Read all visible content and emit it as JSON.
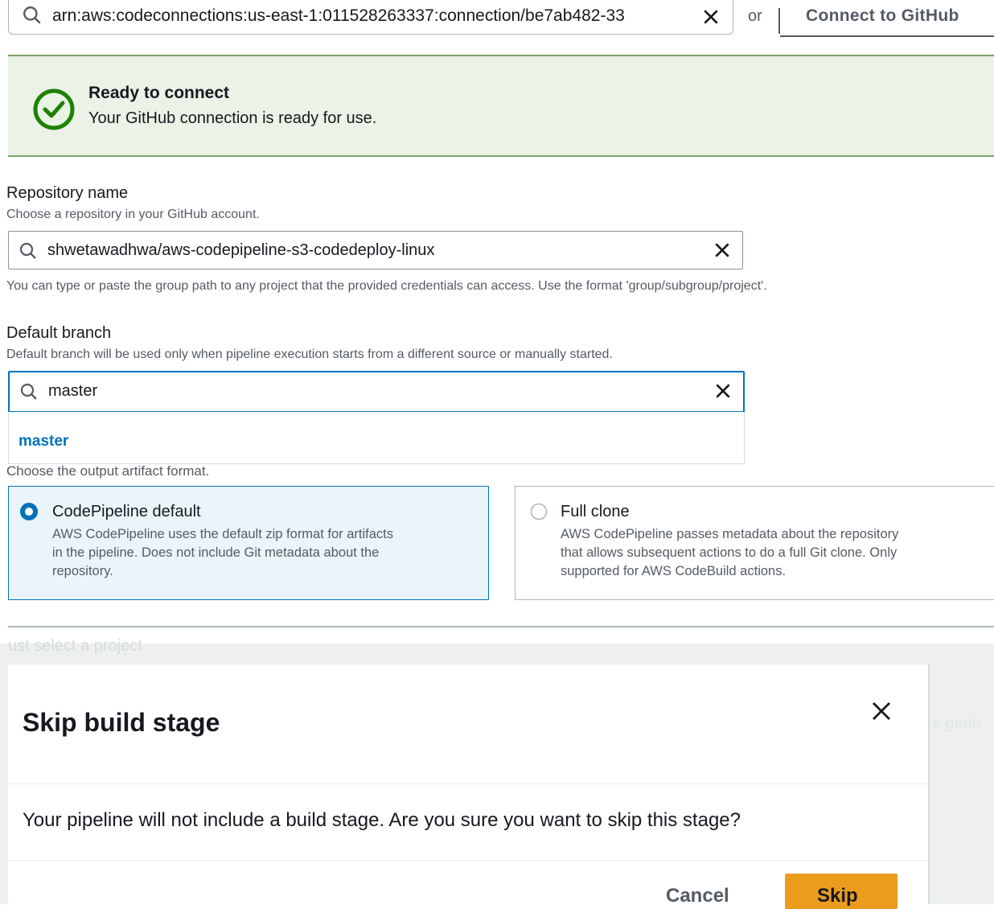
{
  "connection": {
    "value": "arn:aws:codeconnections:us-east-1:011528263337:connection/be7ab482-33",
    "or_label": "or",
    "connect_button": "Connect to GitHub"
  },
  "alert": {
    "title": "Ready to connect",
    "message": "Your GitHub connection is ready for use."
  },
  "repository": {
    "label": "Repository name",
    "description": "Choose a repository in your GitHub account.",
    "value": "shwetawadhwa/aws-codepipeline-s3-codedeploy-linux",
    "hint": "You can type or paste the group path to any project that the provided credentials can access. Use the format 'group/subgroup/project'."
  },
  "branch": {
    "label": "Default branch",
    "description": "Default branch will be used only when pipeline execution starts from a different source or manually started.",
    "value": "master",
    "dropdown_option": "master"
  },
  "artifact": {
    "description": "Choose the output artifact format.",
    "options": [
      {
        "title": "CodePipeline default",
        "body": [
          "AWS CodePipeline uses the default zip format for artifacts",
          "in the pipeline. Does not include Git metadata about the",
          "repository."
        ],
        "selected": true
      },
      {
        "title": "Full clone",
        "body": [
          "AWS CodePipeline passes metadata about the repository",
          "that allows subsequent actions to do a full Git clone. Only",
          "supported for AWS CodeBuild actions."
        ],
        "selected": false
      }
    ]
  },
  "background": {
    "text_left": "ust select a project",
    "text_right": "s gene"
  },
  "modal": {
    "title": "Skip build stage",
    "body": "Your pipeline will not include a build stage. Are you sure you want to skip this stage?",
    "cancel_label": "Cancel",
    "skip_label": "Skip"
  },
  "colors": {
    "success": "#1d8102",
    "link": "#0073bb",
    "primary_button": "#ec9c1d"
  }
}
